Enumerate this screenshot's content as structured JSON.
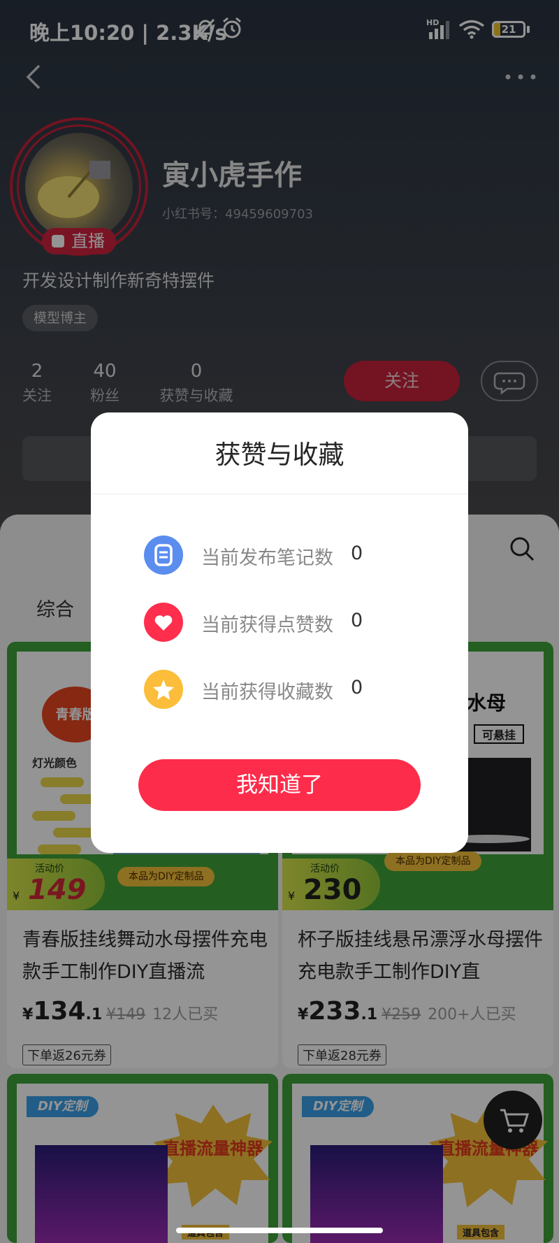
{
  "status_bar": {
    "time": "晚上10:20",
    "separator": "|",
    "speed": "2.3K/s",
    "signal_label": "HD",
    "battery": "21",
    "battery_level": 0.21
  },
  "profile": {
    "name": "寅小虎手作",
    "id_label": "小红书号：49459609703",
    "live_badge": "直播",
    "bio": "开发设计制作新奇特摆件",
    "tag": "模型博主",
    "stats": [
      {
        "num": "2",
        "label": "关注"
      },
      {
        "num": "40",
        "label": "粉丝"
      },
      {
        "num": "0",
        "label": "获赞与收藏"
      }
    ],
    "follow_label": "关注"
  },
  "tabs": {
    "all": "综合"
  },
  "products": [
    {
      "title": "青春版挂线舞动水母摆件充电款手工制作DIY直播流",
      "yen": "¥",
      "price_main": "134",
      "price_dec": ".1",
      "orig_price": "¥149",
      "sold": "12人已买",
      "coupon": "下单返26元券",
      "img_activity": "活动价",
      "img_yen": "¥",
      "img_price": "149",
      "img_note": "本品为DIY定制品",
      "img_badge": "青春版",
      "img_light": "灯光颜色"
    },
    {
      "title": "杯子版挂线悬吊漂浮水母摆件充电款手工制作DIY直",
      "yen": "¥",
      "price_main": "233",
      "price_dec": ".1",
      "orig_price": "¥259",
      "sold": "200+人已买",
      "coupon": "下单返28元券",
      "img_activity": "活动价",
      "img_yen": "¥",
      "img_price": "230",
      "img_note": "本品为DIY定制品",
      "img_head": "水母",
      "img_hang": "可悬挂"
    }
  ],
  "promo_cards": [
    {
      "ribbon": "DIY定制",
      "burst": "直播流量神器",
      "bag": "道具包含"
    },
    {
      "ribbon": "DIY定制",
      "burst": "直播流量神器",
      "bag": "道具包含"
    }
  ],
  "dialog": {
    "title": "获赞与收藏",
    "rows": [
      {
        "label": "当前发布笔记数",
        "value": "0",
        "icon": "note-icon",
        "color": "#5b8def"
      },
      {
        "label": "当前获得点赞数",
        "value": "0",
        "icon": "heart-icon",
        "color": "#ff2e4d"
      },
      {
        "label": "当前获得收藏数",
        "value": "0",
        "icon": "star-icon",
        "color": "#fbbd3a"
      }
    ],
    "button": "我知道了"
  },
  "colors": {
    "accent": "#fe2c4b",
    "follow": "#c8223a",
    "product_green": "#3fa33a"
  }
}
